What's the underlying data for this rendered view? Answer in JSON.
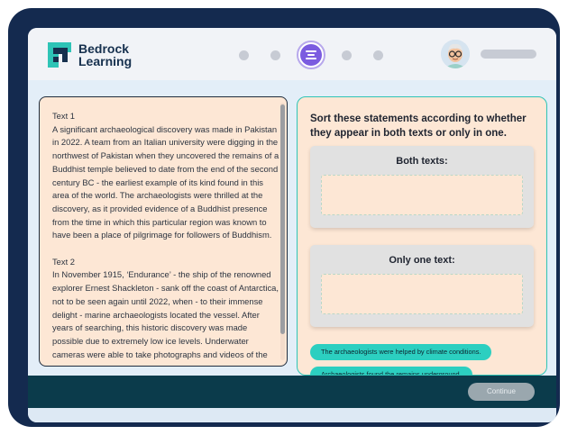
{
  "brand": {
    "line1": "Bedrock",
    "line2": "Learning",
    "color": "#16304e",
    "accent": "#2ec4b6"
  },
  "progress": {
    "steps": 5,
    "current": 3
  },
  "user": {
    "avatar": "avatar-icon"
  },
  "text_panel": {
    "paragraphs": [
      "Text 1",
      "A significant archaeological discovery was made in Pakistan in 2022. A team from an Italian university were digging in the northwest of Pakistan when they uncovered the remains of a Buddhist temple believed to date from the end of the second century BC - the earliest example of its kind found in this area of the world. The archaeologists were thrilled at the discovery, as it provided evidence of a Buddhist presence from the time in which this particular region was known to have been a place of pilgrimage for followers of Buddhism.",
      "Text 2",
      "In November 1915, ‘Endurance’ - the ship of the renowned explorer Ernest Shackleton - sank off the coast of Antarctica, not to be seen again until 2022, when - to their immense delight - marine archaeologists located the vessel. After years of searching, this historic discovery was made possible due to extremely low ice levels. Underwater cameras were able to take photographs and videos of the"
    ]
  },
  "task": {
    "instruction": "Sort these statements according to whether they appear in both texts or only in one.",
    "bucket_both": "Both texts:",
    "bucket_one": "Only one text:",
    "chips": [
      "The archaeologists were helped by climate conditions.",
      "Archaeologists found the remains underground."
    ]
  },
  "footer": {
    "continue_label": "Continue"
  }
}
